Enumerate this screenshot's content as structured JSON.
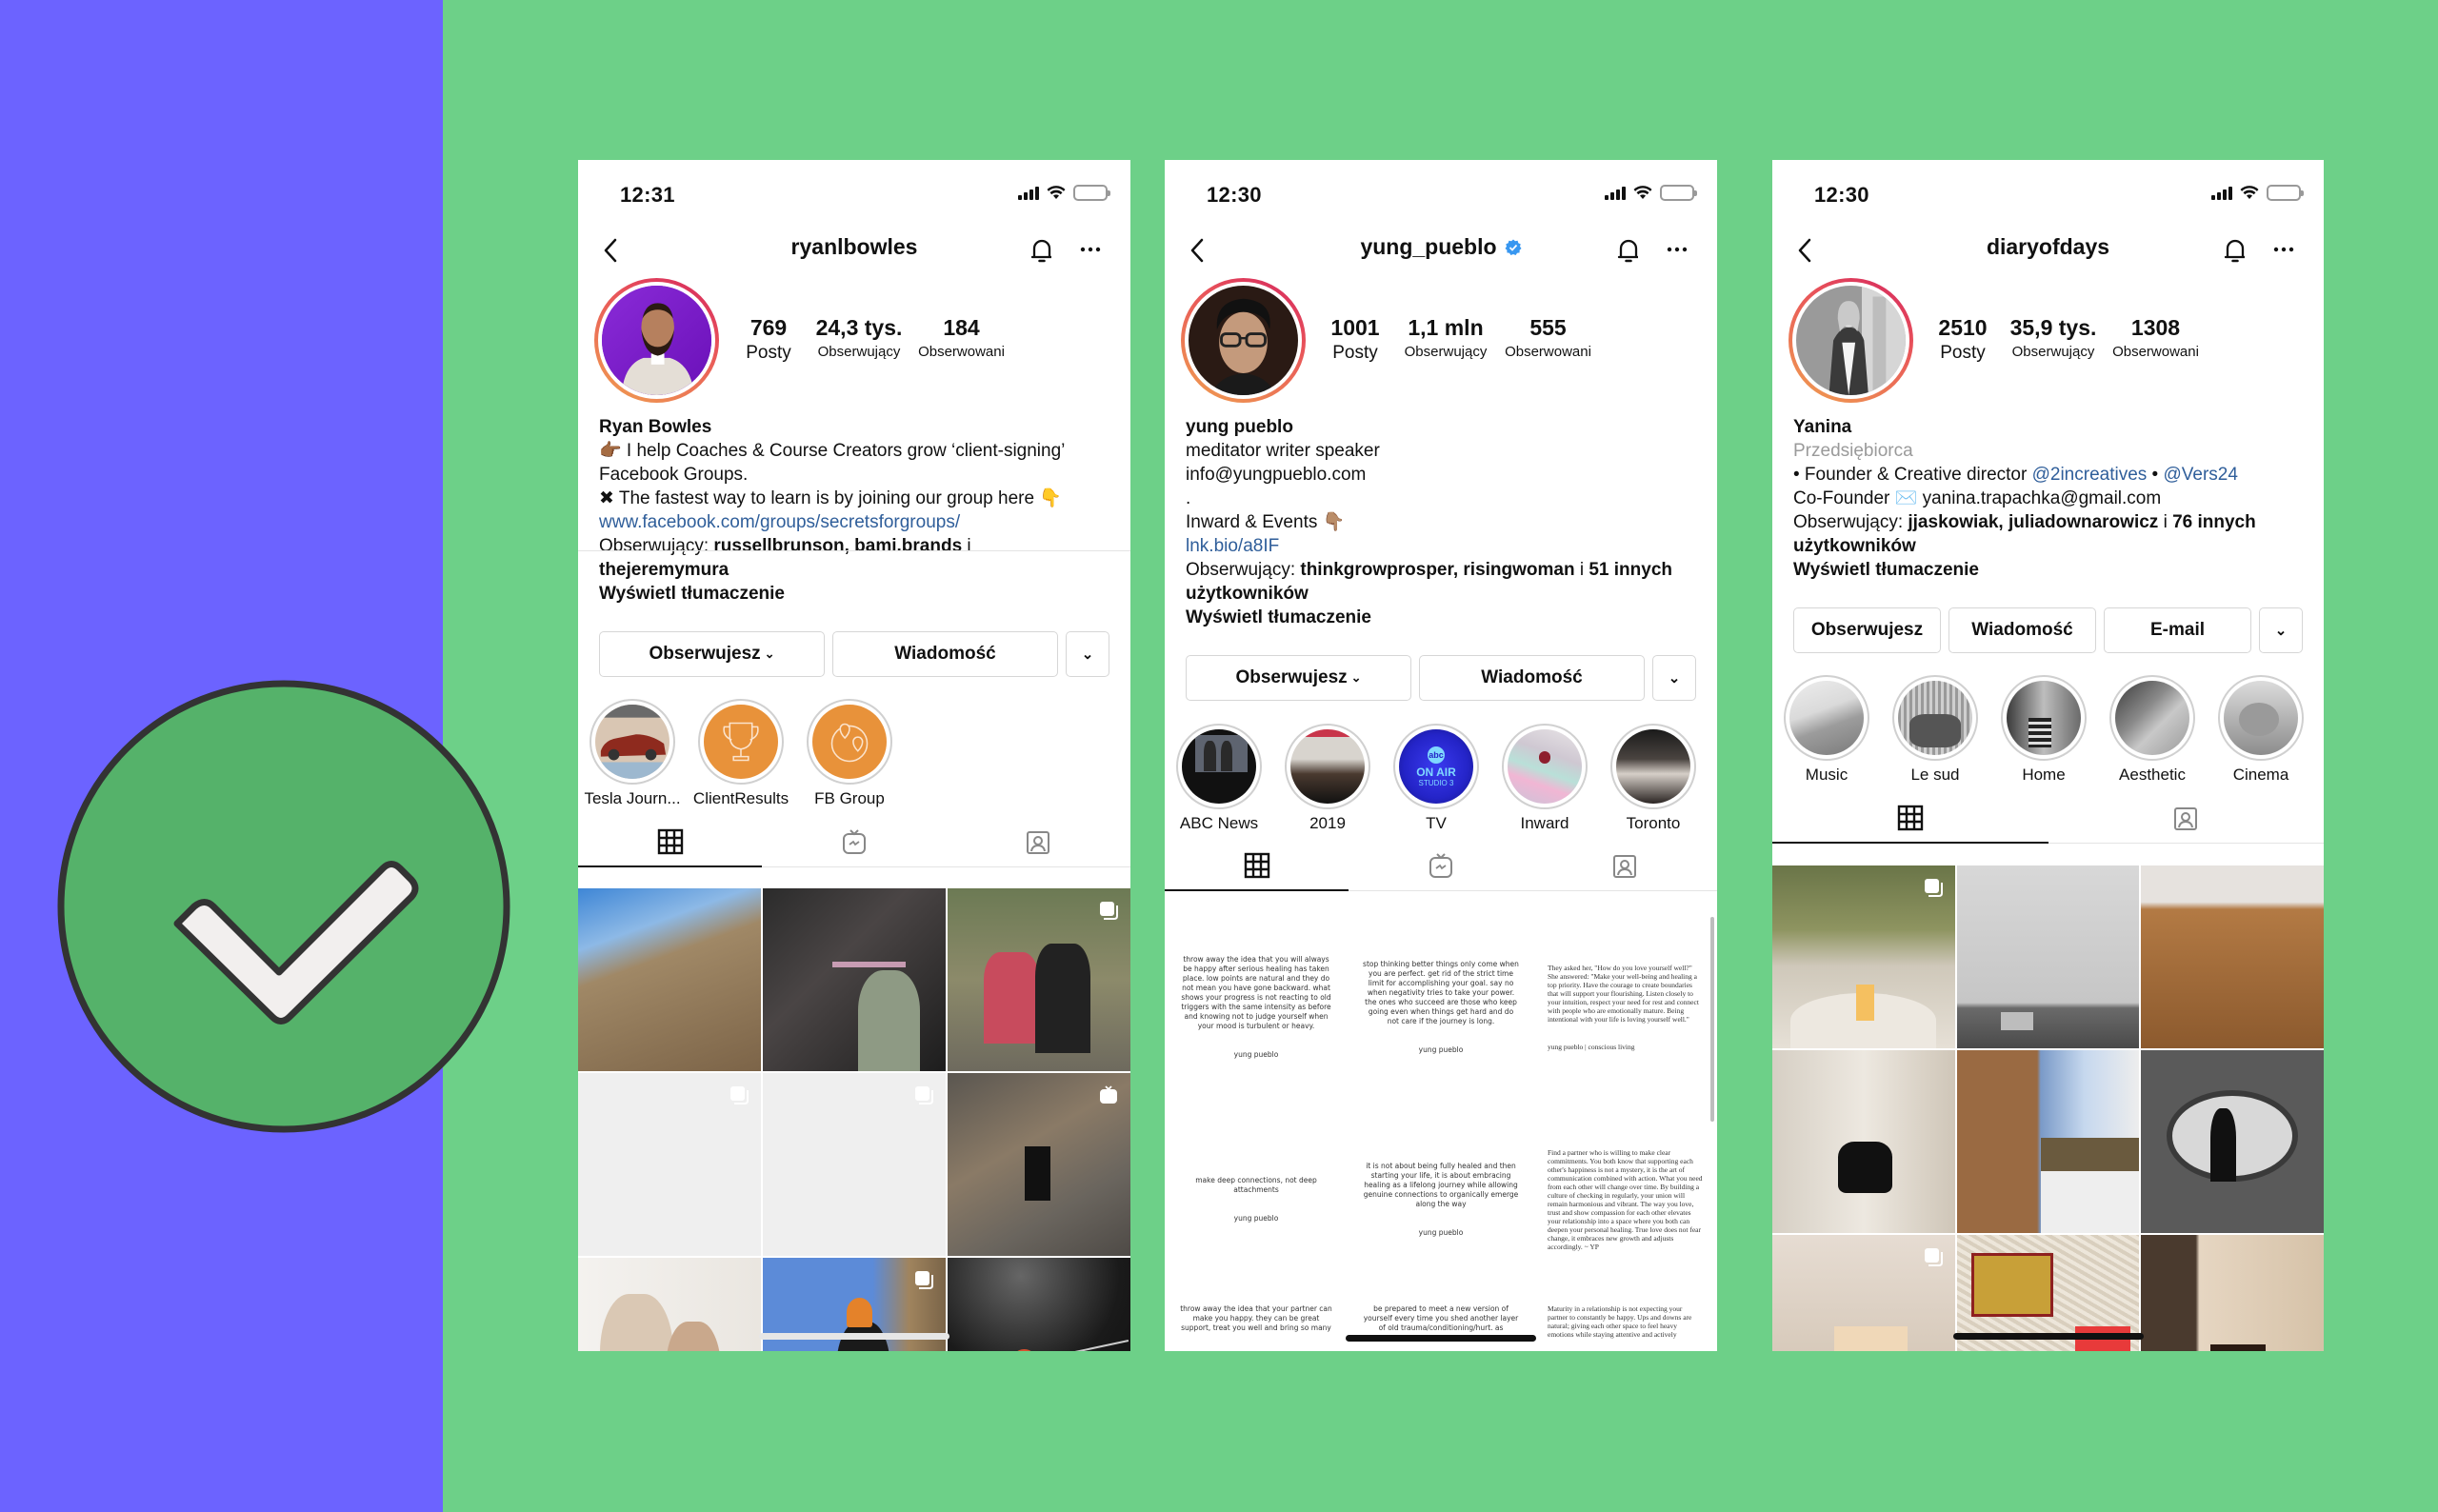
{
  "colors": {
    "left_band": "#6C63FF",
    "background": "#6DD088",
    "check_fill": "#55B26A",
    "check_outline": "#333333",
    "check_mark": "#F2EFEE",
    "link": "#2F5E9A",
    "highlight_orange": "#E8923A"
  },
  "badge": {
    "icon": "checkmark-circle-icon"
  },
  "phones": [
    {
      "status": {
        "time": "12:31",
        "battery_percent": 20
      },
      "header": {
        "username": "ryanlbowles",
        "verified": false
      },
      "stats": [
        {
          "value": "769",
          "label": "Posty"
        },
        {
          "value": "24,3 tys.",
          "label": "Obserwujący"
        },
        {
          "value": "184",
          "label": "Obserwowani"
        }
      ],
      "bio": {
        "name": "Ryan Bowles",
        "line1": "👉🏾 I help Coaches & Course Creators grow ‘client-signing’",
        "line2": "Facebook Groups.",
        "line3": " ✖ The fastest way to learn is by joining our group here 👇",
        "link": "www.facebook.com/groups/secretsforgroups/",
        "followed_prefix": "Obserwujący: ",
        "followed_names": "russellbrunson, bami.brands",
        "followed_and": " i",
        "followed_more": "thejeremymura",
        "translate": "Wyświetl tłumaczenie"
      },
      "actions": {
        "follow": "Obserwujesz",
        "message": "Wiadomość",
        "more": "⌄"
      },
      "highlights": [
        {
          "label": "Tesla Journ..."
        },
        {
          "label": "ClientResults"
        },
        {
          "label": "FB Group"
        }
      ],
      "tabs": [
        "grid",
        "igtv",
        "tagged"
      ],
      "grid_note": "9 posts visible"
    },
    {
      "status": {
        "time": "12:30",
        "battery_percent": 20
      },
      "header": {
        "username": "yung_pueblo",
        "verified": true
      },
      "stats": [
        {
          "value": "1001",
          "label": "Posty"
        },
        {
          "value": "1,1 mln",
          "label": "Obserwujący"
        },
        {
          "value": "555",
          "label": "Obserwowani"
        }
      ],
      "bio": {
        "name": "yung pueblo",
        "line1": "meditator writer speaker",
        "line2": "info@yungpueblo.com",
        "line3": ".",
        "line4": "Inward & Events 👇🏽",
        "link": "lnk.bio/a8IF",
        "followed_prefix": "Obserwujący: ",
        "followed_names": "thinkgrowprosper, risingwoman",
        "followed_and": " i ",
        "followed_count": "51 innych",
        "followed_more": "użytkowników",
        "translate": "Wyświetl tłumaczenie"
      },
      "actions": {
        "follow": "Obserwujesz",
        "message": "Wiadomość",
        "more": "⌄"
      },
      "highlights": [
        {
          "label": "ABC News"
        },
        {
          "label": "2019"
        },
        {
          "label": "TV",
          "text": "ON AIR",
          "subtext": "STUDIO 3",
          "logo": "abc"
        },
        {
          "label": "Inward"
        },
        {
          "label": "Toronto"
        }
      ],
      "tabs": [
        "grid",
        "igtv",
        "tagged"
      ],
      "quotes": [
        {
          "text": "throw away the idea that you will always be happy after serious healing has taken place. low points are natural and they do not mean you have gone backward. what shows your progress is not reacting to old triggers with the same intensity as before and knowing not to judge yourself when your mood is turbulent or heavy.",
          "sig": "yung pueblo"
        },
        {
          "text": "stop thinking better things only come when you are perfect. get rid of the strict time limit for accomplishing your goal. say no when negativity tries to take your power. the ones who succeed are those who keep going even when things get hard and do not care if the journey is long.",
          "sig": "yung pueblo"
        },
        {
          "text": "They asked her, \"How do you love yourself well?\" She answered: \"Make your well-being and healing a top priority. Have the courage to create boundaries that will support your flourishing. Listen closely to your intuition, respect your need for rest and connect with people who are emotionally mature. Being intentional with your life is loving yourself well.\"",
          "sig": "yung pueblo | conscious living",
          "serif": true
        },
        {
          "text": "make deep connections, not deep attachments",
          "sig": "yung pueblo"
        },
        {
          "text": "it is not about being fully healed and then starting your life, it is about embracing healing as a lifelong journey while allowing genuine connections to organically emerge along the way",
          "sig": "yung pueblo"
        },
        {
          "text": "Find a partner who is willing to make clear commitments. You both know that supporting each other's happiness is not a mystery, it is the art of communication combined with action. What you need from each other will change over time. By building a culture of checking in regularly, your union will remain harmonious and vibrant. The way you love, trust and show compassion for each other elevates your relationship into a space where you both can deepen your personal healing. True love does not fear change, it embraces new growth and adjusts accordingly. ~ YP",
          "sig": "",
          "serif": true
        },
        {
          "text": "throw away the idea that your partner can make you happy. they can be great support, treat you well and bring so many",
          "sig": ""
        },
        {
          "text": "be prepared to meet a new version of yourself every time you shed another layer of old trauma/conditioning/hurt. as",
          "sig": ""
        },
        {
          "text": "Maturity in a relationship is not expecting your partner to constantly be happy. Ups and downs are natural; giving each other space to feel heavy emotions while staying attentive and actively",
          "sig": "",
          "serif": true
        }
      ]
    },
    {
      "status": {
        "time": "12:30",
        "battery_percent": 20
      },
      "header": {
        "username": "diaryofdays",
        "verified": false
      },
      "stats": [
        {
          "value": "2510",
          "label": "Posty"
        },
        {
          "value": "35,9 tys.",
          "label": "Obserwujący"
        },
        {
          "value": "1308",
          "label": "Obserwowani"
        }
      ],
      "bio": {
        "name": "Yanina",
        "category": "Przedsiębiorca",
        "line1_prefix": "• Founder & Creative director ",
        "mention1": "@2increatives",
        "sep": " • ",
        "mention2": "@Vers24",
        "line2_prefix": "Co-Founder ✉️ ",
        "email": "yanina.trapachka@gmail.com",
        "followed_prefix": "Obserwujący: ",
        "followed_names": "jjaskowiak, juliadownarowicz",
        "followed_and": " i ",
        "followed_count": "76 innych",
        "followed_more": "użytkowników",
        "translate": "Wyświetl tłumaczenie"
      },
      "actions": {
        "follow": "Obserwujesz",
        "message": "Wiadomość",
        "email": "E-mail",
        "more": "⌄"
      },
      "highlights": [
        {
          "label": "Music"
        },
        {
          "label": "Le sud"
        },
        {
          "label": "Home"
        },
        {
          "label": "Aesthetic"
        },
        {
          "label": "Cinema"
        }
      ],
      "tabs": [
        "grid",
        "tagged"
      ]
    }
  ]
}
